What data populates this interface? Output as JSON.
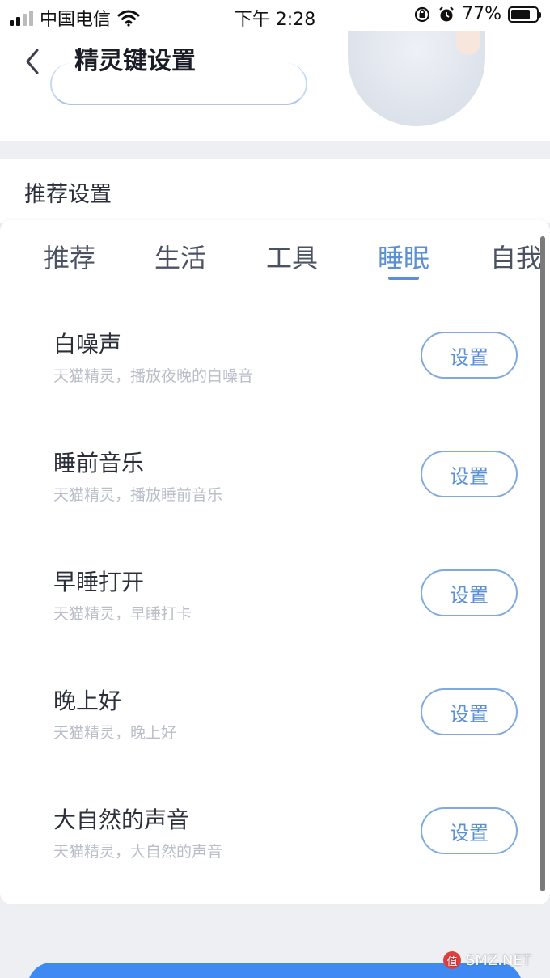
{
  "status_bar": {
    "carrier": "中国电信",
    "time": "下午 2:28",
    "battery_percent": "77%",
    "battery_level": 0.77
  },
  "header": {
    "title": "精灵键设置",
    "back_icon": "chevron-left-icon"
  },
  "section": {
    "title": "推荐设置"
  },
  "tabs": [
    {
      "label": "推荐",
      "active": false
    },
    {
      "label": "生活",
      "active": false
    },
    {
      "label": "工具",
      "active": false
    },
    {
      "label": "睡眠",
      "active": true
    },
    {
      "label": "自我",
      "active": false
    }
  ],
  "items": [
    {
      "title": "白噪声",
      "desc": "天猫精灵，播放夜晚的白噪音",
      "button": "设置"
    },
    {
      "title": "睡前音乐",
      "desc": "天猫精灵，播放睡前音乐",
      "button": "设置"
    },
    {
      "title": "早睡打开",
      "desc": "天猫精灵，早睡打卡",
      "button": "设置"
    },
    {
      "title": "晚上好",
      "desc": "天猫精灵，晚上好",
      "button": "设置"
    },
    {
      "title": "大自然的声音",
      "desc": "天猫精灵，大自然的声音",
      "button": "设置"
    }
  ],
  "watermark": {
    "logo_text": "值",
    "text": "SMZ.NET"
  },
  "colors": {
    "accent": "#5b8fd6",
    "primary_button": "#3e8af2",
    "background": "#eeeff3"
  }
}
